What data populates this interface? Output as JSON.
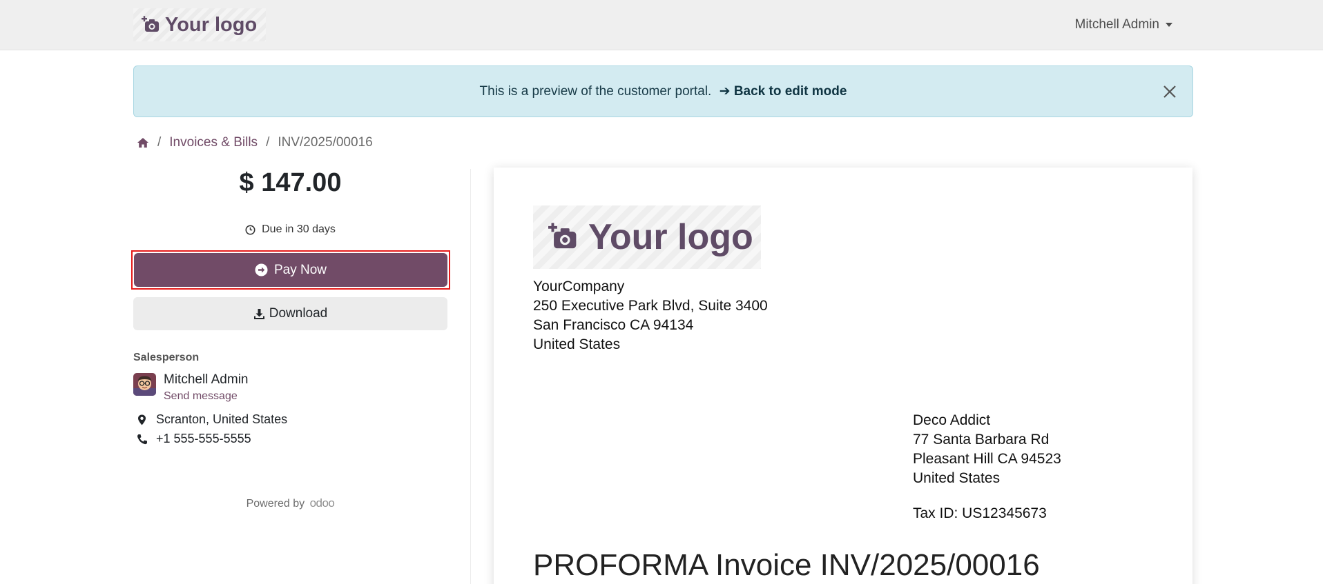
{
  "header": {
    "logo_text": "Your logo",
    "user_name": "Mitchell Admin"
  },
  "alert": {
    "message": "This is a preview of the customer portal.",
    "link_label": "Back to edit mode",
    "link_arrow": "➔"
  },
  "breadcrumb": {
    "items": [
      "Invoices & Bills",
      "INV/2025/00016"
    ],
    "separator": "/"
  },
  "sidebar": {
    "amount": "$ 147.00",
    "due": "Due in 30 days",
    "pay_label": "Pay Now",
    "download_label": "Download",
    "salesperson_heading": "Salesperson",
    "salesperson_name": "Mitchell Admin",
    "send_message": "Send message",
    "location": "Scranton, United States",
    "phone": "+1 555-555-5555",
    "powered_by": "Powered by",
    "powered_brand": "odoo"
  },
  "document": {
    "logo_text": "Your logo",
    "company": [
      "YourCompany",
      "250 Executive Park Blvd, Suite 3400",
      "San Francisco CA 94134",
      "United States"
    ],
    "customer": [
      "Deco Addict",
      "77 Santa Barbara Rd",
      "Pleasant Hill CA 94523",
      "United States"
    ],
    "tax_id": "Tax ID: US12345673",
    "title": "PROFORMA Invoice INV/2025/00016"
  },
  "colors": {
    "brand": "#714b67",
    "alert_bg": "#d3ebf1",
    "topbar_bg": "#efefef",
    "highlight_border": "#e51a1a"
  },
  "icons": [
    "camera-plus-icon",
    "chevron-down-icon",
    "close-icon",
    "home-icon",
    "clock-icon",
    "arrow-circle-right-icon",
    "download-icon",
    "map-marker-icon",
    "phone-icon"
  ]
}
